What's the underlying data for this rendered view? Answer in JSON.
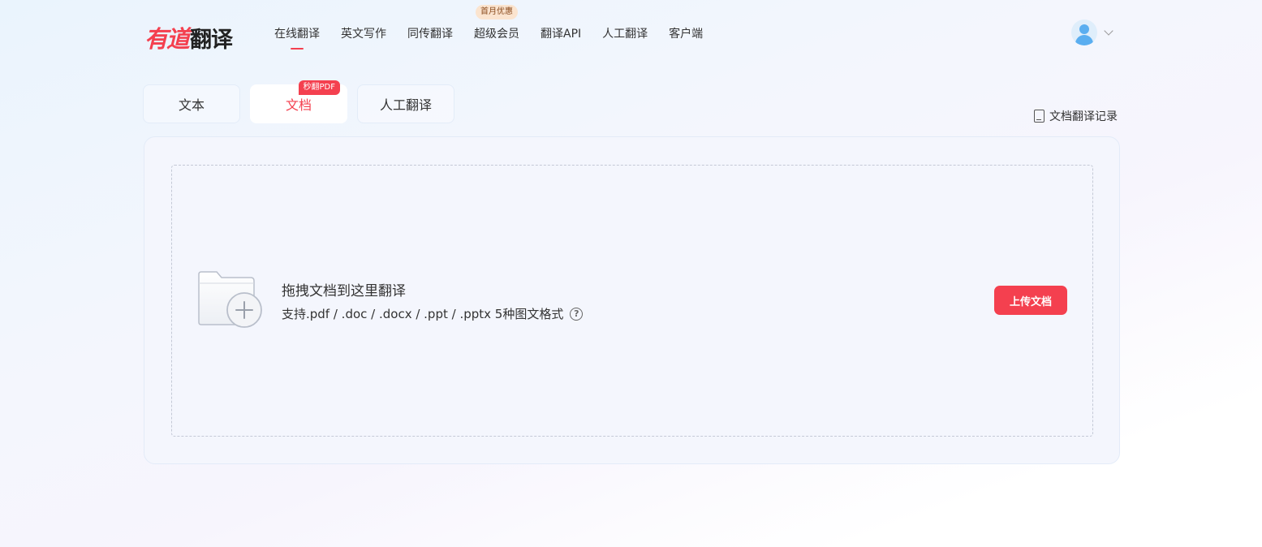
{
  "colors": {
    "accent": "#f4404f",
    "badge_bg": "#fbe4cf",
    "badge_text": "#8a4a1c"
  },
  "logo": {
    "brand": "有道",
    "product": "翻译"
  },
  "nav": {
    "items": [
      {
        "label": "在线翻译",
        "active": true
      },
      {
        "label": "英文写作"
      },
      {
        "label": "同传翻译"
      },
      {
        "label": "超级会员",
        "badge": "首月优惠"
      },
      {
        "label": "翻译API"
      },
      {
        "label": "人工翻译"
      },
      {
        "label": "客户端"
      }
    ]
  },
  "user": {
    "avatar_icon": "user-avatar-icon",
    "menu_icon": "chevron-down-icon"
  },
  "tabs": [
    {
      "label": "文本"
    },
    {
      "label": "文档",
      "active": true,
      "badge": "秒翻PDF"
    },
    {
      "label": "人工翻译"
    }
  ],
  "history": {
    "label": "文档翻译记录",
    "icon": "document-icon"
  },
  "dropzone": {
    "title": "拖拽文档到这里翻译",
    "subtitle": "支持.pdf / .doc / .docx / .ppt / .pptx 5种图文格式",
    "help_icon": "?",
    "upload_label": "上传文档"
  }
}
